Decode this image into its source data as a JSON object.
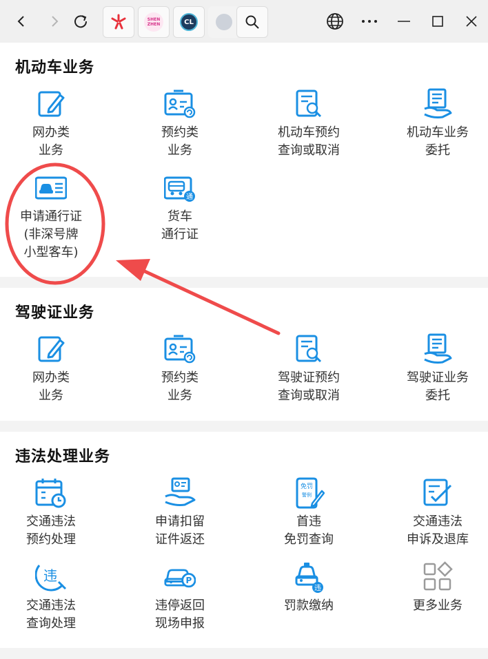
{
  "browser": {
    "tabs": [
      {
        "icon": "red-app-icon"
      },
      {
        "icon": "shenzhen-logo-icon",
        "text": "SHEN ZHEN"
      },
      {
        "icon": "cl-logo-icon",
        "text": "CL"
      },
      {
        "icon": "blank-site-icon"
      }
    ]
  },
  "sections": [
    {
      "title": "机动车业务",
      "items": [
        {
          "line1": "网办类",
          "line2": "业务",
          "icon": "edit-document-icon"
        },
        {
          "line1": "预约类",
          "line2": "业务",
          "icon": "id-card-refresh-icon"
        },
        {
          "line1": "机动车预约",
          "line2": "查询或取消",
          "icon": "document-search-icon"
        },
        {
          "line1": "机动车业务",
          "line2": "委托",
          "icon": "hand-document-icon"
        },
        {
          "line1": "申请通行证",
          "line2": "(非深号牌",
          "line3": "小型客车)",
          "icon": "car-pass-card-icon"
        },
        {
          "line1": "货车",
          "line2": "通行证",
          "icon": "truck-pass-icon",
          "badge": "通"
        }
      ]
    },
    {
      "title": "驾驶证业务",
      "items": [
        {
          "line1": "网办类",
          "line2": "业务",
          "icon": "edit-document-icon"
        },
        {
          "line1": "预约类",
          "line2": "业务",
          "icon": "id-card-refresh-icon"
        },
        {
          "line1": "驾驶证预约",
          "line2": "查询或取消",
          "icon": "document-search-icon"
        },
        {
          "line1": "驾驶证业务",
          "line2": "委托",
          "icon": "hand-document-icon"
        }
      ]
    },
    {
      "title": "违法处理业务",
      "items": [
        {
          "line1": "交通违法",
          "line2": "预约处理",
          "icon": "calendar-clock-icon"
        },
        {
          "line1": "申请扣留",
          "line2": "证件返还",
          "icon": "hand-card-icon"
        },
        {
          "line1": "首违",
          "line2": "免罚查询",
          "icon": "exempt-penalty-icon",
          "badge1": "免罚",
          "badge2": "警例"
        },
        {
          "line1": "交通违法",
          "line2": "申诉及退库",
          "icon": "edit-check-icon"
        },
        {
          "line1": "交通违法",
          "line2": "查询处理",
          "icon": "violation-search-icon",
          "badge": "违"
        },
        {
          "line1": "违停返回",
          "line2": "现场申报",
          "icon": "parking-car-icon",
          "badge": "P"
        },
        {
          "line1": "罚款缴纳",
          "icon": "police-car-fine-icon",
          "badge": "违"
        },
        {
          "line1": "更多业务",
          "icon": "more-grid-icon"
        }
      ]
    }
  ],
  "colors": {
    "primary": "#1a8fe3",
    "annotation": "#ef4b4b",
    "text": "#333333",
    "title": "#111111"
  }
}
